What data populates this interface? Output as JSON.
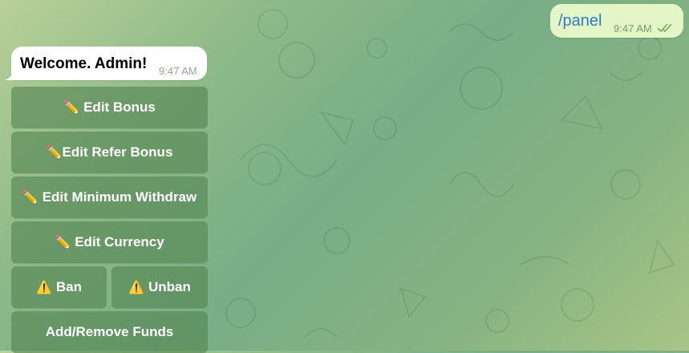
{
  "messages": {
    "outgoing": {
      "text": "/panel",
      "time": "9:47 AM",
      "status_icon": "double-check-icon"
    },
    "incoming": {
      "text": "Welcome. Admin!",
      "time": "9:47 AM"
    }
  },
  "keyboard": {
    "edit_bonus": {
      "icon": "✏️",
      "label": "Edit Bonus"
    },
    "edit_refer_bonus": {
      "icon": "✏️",
      "label": "Edit Refer Bonus"
    },
    "edit_min_withdraw": {
      "icon": "✏️",
      "label": "Edit Minimum Withdraw"
    },
    "edit_currency": {
      "icon": "✏️",
      "label": "Edit Currency"
    },
    "ban": {
      "icon": "⚠️",
      "label": "Ban"
    },
    "unban": {
      "icon": "⚠️",
      "label": "Unban"
    },
    "add_remove_funds": {
      "label": "Add/Remove Funds"
    }
  },
  "colors": {
    "outgoing_bubble": "#e4f6c8",
    "incoming_bubble": "#ffffff",
    "keyboard_button": "#548452",
    "link_text": "#2e7bc0"
  }
}
